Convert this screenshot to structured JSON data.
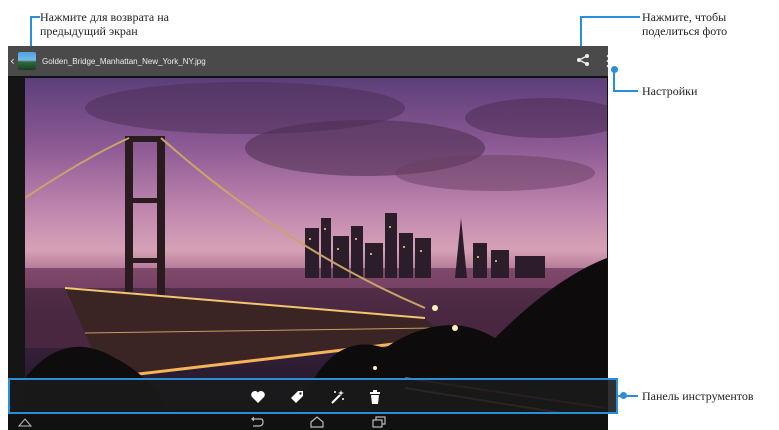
{
  "callouts": {
    "back": "Нажмите для возврата на\nпредыдущий экран",
    "share": "Нажмите, чтобы\nподелиться фото",
    "settings": "Настройки",
    "toolbar": "Панель инструментов"
  },
  "topbar": {
    "filename": "Golden_Bridge_Manhattan_New_York_NY.jpg"
  },
  "toolbar_icons": [
    "favorite-icon",
    "tag-icon",
    "magic-wand-icon",
    "trash-icon"
  ],
  "navbar_icons": [
    "home-up-icon",
    "back-icon",
    "home-icon",
    "recent-apps-icon"
  ],
  "colors": {
    "accent": "#2a8fd6",
    "topbar": "#4a4a4a",
    "toolbar": "#191919"
  }
}
